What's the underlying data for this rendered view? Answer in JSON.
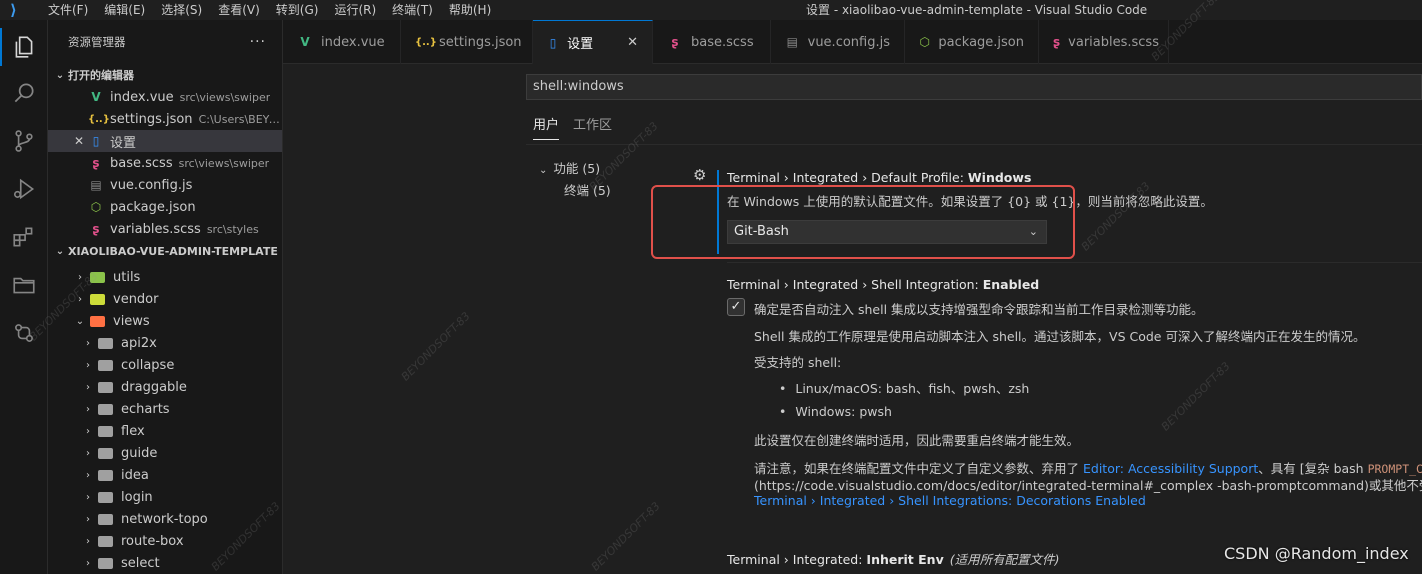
{
  "titlebar": {
    "menu": [
      "文件(F)",
      "编辑(E)",
      "选择(S)",
      "查看(V)",
      "转到(G)",
      "运行(R)",
      "终端(T)",
      "帮助(H)"
    ],
    "window_title": "设置 - xiaolibao-vue-admin-template - Visual Studio Code"
  },
  "sidebar": {
    "title": "资源管理器",
    "more": "···",
    "open_editors_label": "打开的编辑器",
    "open_editors": [
      {
        "name": "index.vue",
        "path": "src\\views\\swiper"
      },
      {
        "name": "settings.json",
        "path": "C:\\Users\\BEYON..."
      },
      {
        "name": "设置",
        "path": ""
      },
      {
        "name": "base.scss",
        "path": "src\\views\\swiper"
      },
      {
        "name": "vue.config.js",
        "path": ""
      },
      {
        "name": "package.json",
        "path": ""
      },
      {
        "name": "variables.scss",
        "path": "src\\styles"
      }
    ],
    "project_label": "XIAOLIBAO-VUE-ADMIN-TEMPLATE",
    "tree": [
      "utils",
      "vendor",
      "views",
      "api2x",
      "collapse",
      "draggable",
      "echarts",
      "flex",
      "guide",
      "idea",
      "login",
      "network-topo",
      "route-box",
      "select"
    ]
  },
  "tabs": [
    {
      "name": "index.vue",
      "icon": "vue-icon"
    },
    {
      "name": "settings.json",
      "icon": "json-icon"
    },
    {
      "name": "设置",
      "icon": "file-icon",
      "close": "✕"
    },
    {
      "name": "base.scss",
      "icon": "sass-icon"
    },
    {
      "name": "vue.config.js",
      "icon": "js-file-icon"
    },
    {
      "name": "package.json",
      "icon": "node-icon"
    },
    {
      "name": "variables.scss",
      "icon": "sass-icon"
    }
  ],
  "settings": {
    "search_value": "shell:windows",
    "scope_tabs": [
      "用户",
      "工作区"
    ],
    "toc": [
      "功能 (5)",
      "终端 (5)"
    ],
    "s1": {
      "prefix": "Terminal › Integrated › Default Profile: ",
      "name": "Windows",
      "desc": "在 Windows 上使用的默认配置文件。如果设置了 {0} 或 {1}，则当前将忽略此设置。",
      "value": "Git-Bash"
    },
    "s2": {
      "prefix": "Terminal › Integrated › Shell Integration: ",
      "name": "Enabled",
      "check": "✓",
      "line1": "确定是否自动注入 shell 集成以支持增强型命令跟踪和当前工作目录检测等功能。",
      "line2": "Shell 集成的工作原理是使用启动脚本注入 shell。通过该脚本，VS Code 可深入了解终端内正在发生的情况。",
      "line3": "受支持的 shell:",
      "bullet1": "Linux/macOS: bash、fish、pwsh、zsh",
      "bullet2": "Windows: pwsh",
      "line4": "此设置仅在创建终端时适用，因此需要重启终端才能生效。",
      "line5a": "请注意，如果在终端配置文件中定义了自定义参数、弃用了 ",
      "line5link": "Editor: Accessibility Support",
      "line5b": "、具有 [复杂 bash ",
      "line5code": "PROMPT_COMMAND",
      "line6a": "(https://code.visualstudio.com/docs/editor/integrated-terminal#_complex",
      "line6b": " -bash-promptcommand)或其他不受支持的设置，",
      "line7link": "Terminal › Integrated › Shell Integrations: Decorations Enabled"
    },
    "s3": {
      "prefix": "Terminal › Integrated: ",
      "name": "Inherit Env",
      "note": "(适用所有配置文件)"
    }
  },
  "watermark": "BEYONDSOFT-83",
  "credit": "CSDN @Random_index",
  "colors": {
    "accent": "#0078d4",
    "highlight_box": "#e0504a",
    "link": "#3794ff"
  }
}
